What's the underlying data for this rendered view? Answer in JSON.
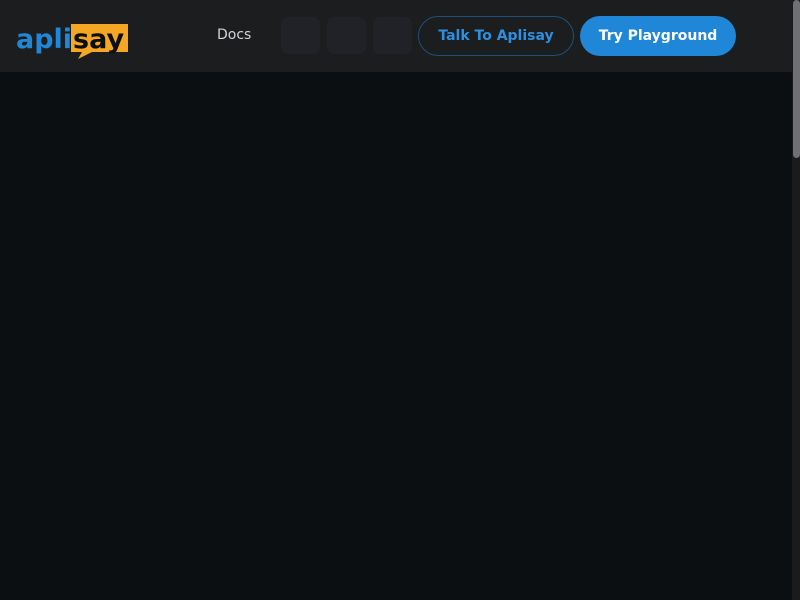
{
  "brand": {
    "logo_text_part1": "apli",
    "logo_text_part2": "say",
    "primary_color": "#1f86d8",
    "accent_color": "#f5a623"
  },
  "nav": {
    "docs_label": "Docs",
    "icon_buttons": [
      {
        "name": "nav-icon-button-1"
      },
      {
        "name": "nav-icon-button-2"
      },
      {
        "name": "nav-icon-button-3"
      }
    ]
  },
  "actions": {
    "talk_label": "Talk To Aplisay",
    "playground_label": "Try Playground"
  }
}
